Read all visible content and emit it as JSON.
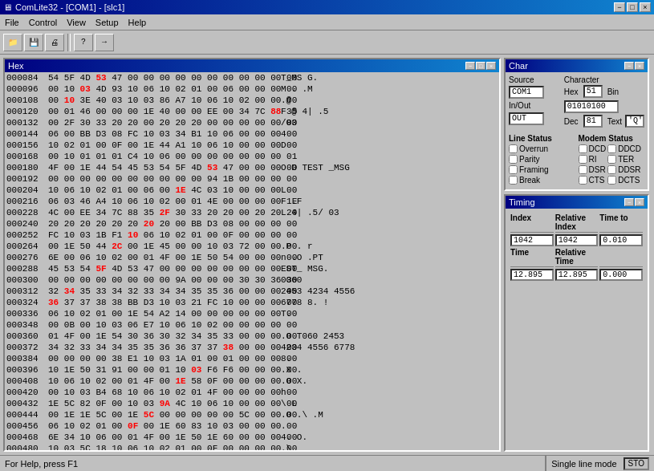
{
  "titleBar": {
    "title": "ComLite32 - [COM1] - [slc1]",
    "minimizeBtn": "−",
    "maximizeBtn": "□",
    "closeBtn": "×"
  },
  "menuBar": {
    "items": [
      "File",
      "Control",
      "View",
      "Setup",
      "Help"
    ]
  },
  "toolbar": {
    "buttons": [
      "▶",
      "■",
      "✕",
      "?",
      "→"
    ]
  },
  "hexWindow": {
    "title": "Hex",
    "rows": [
      {
        "addr": "000084",
        "bytes": "54 5F 4D 53  47 00 00 00  00 00 00 00  00 00 00 00",
        "ascii": "T_MS G.          "
      },
      {
        "addr": "000096",
        "bytes": "00 10 03 4D  93 10 06 10  02 01 00 06  00 00 00 00",
        "ascii": "   M  .          .M"
      },
      {
        "addr": "000108",
        "bytes": "00 10 3E 40  03 10 03 86  A7 10 06 10  02 00 00 00",
        "ascii": "  .@             "
      },
      {
        "addr": "000120",
        "bytes": "00 01 46 00  00 00 1E 40  00 00 EE 00  34 7C 88 35",
        "ascii": "  F    @         4| .5"
      },
      {
        "addr": "000132",
        "bytes": "00 2F 30 33  20 20 00 20  20 20 00 00  00 00 00 00",
        "ascii": "  /03"
      },
      {
        "addr": "000144",
        "bytes": "06 00 BB D3  08 FC 10 03  34 B1 10 06  00 00 00 00",
        "ascii": "         4"
      },
      {
        "addr": "000156",
        "bytes": "10 02 01 00  0F 00 1E 44  A1 10 06 10  00 00 00 00",
        "ascii": "        D"
      },
      {
        "addr": "000168",
        "bytes": "00 10 01 01  01 C4 10 06  00 00 00 00  00 00 00 01",
        "ascii": "              "
      },
      {
        "addr": "000180",
        "bytes": "4F 00 1E 44  54 45 53 54  5F 4D 53 47  00 00 00 00",
        "ascii": "O  D TEST _MSG"
      },
      {
        "addr": "000192",
        "bytes": "00 00 00 00  00 00 00 00  00 00 94 1B  00 00 00 00",
        "ascii": ""
      },
      {
        "addr": "000204",
        "bytes": "10 06 10 02  01 00 06 00  1E 4C 03 10  00 00 00 00",
        "ascii": "          L"
      },
      {
        "addr": "000216",
        "bytes": "06 03 46 A4  10 06 10 02  00 01 4E 00  00 00 00 1E",
        "ascii": "  F         .F"
      },
      {
        "addr": "000228",
        "bytes": "4C 00 EE 34  7C 88 35 2F  30 33 20 20  00 20 20 20",
        "ascii": "L  4| .5/ 03    "
      },
      {
        "addr": "000240",
        "bytes": "20 20 20 20  20 20 20 20  00 BB D3 08  00 00 00 00",
        "ascii": "              "
      },
      {
        "addr": "000252",
        "bytes": "FC 10 03 1B  F1 10 06 10  02 01 00 0F  00 00 00 00",
        "ascii": "            "
      },
      {
        "addr": "000264",
        "bytes": "00 1E 50 44  2C 00 1E 45  00 00 10 03  72 00 00 00",
        "ascii": "  .P  .       r"
      },
      {
        "addr": "000276",
        "bytes": "6E 00 06 10  02 00 01 4F  00 1E 50 54  00 00 00 00",
        "ascii": "n       .O   .PT"
      },
      {
        "addr": "000288",
        "bytes": "45 53 54 5F  4D 53 47 00  00 00 00 00  00 00 00 00",
        "ascii": "EST_ MSG."
      },
      {
        "addr": "000300",
        "bytes": "00 00 00 00  00 00 00 00  9A 00 00 00  30 30 36 30",
        "ascii": "              0060"
      },
      {
        "addr": "000312",
        "bytes": "32 34 35 33  34 32 33 34  34 35 35 36  00 00 00 00",
        "ascii": "2453 4234 4556"
      },
      {
        "addr": "000324",
        "bytes": "36 37 37 38  38 BB D3 10  03 21 FC 10  00 00 00 00",
        "ascii": "6778 8.   !"
      },
      {
        "addr": "000336",
        "bytes": "06 10 02 01  00 1E 54 A2  14 00 00 00  00 00 00 00",
        "ascii": "      T."
      },
      {
        "addr": "000348",
        "bytes": "00 0B 00 10  03 06 E7 10  06 10 02 00  00 00 00 00",
        "ascii": ""
      },
      {
        "addr": "000360",
        "bytes": "01 4F 00 1E  54 30 36 30  32 34 35 33  00 00 00 00",
        "ascii": "  .O  T060 2453"
      },
      {
        "addr": "000372",
        "bytes": "34 32 33 34  34 35 35 36  36 37 37 38  00 00 00 00",
        "ascii": "4234 4556 6778"
      },
      {
        "addr": "000384",
        "bytes": "00 00 00 00  38 E1 10 03  1A 01 00 01  00 00 00 00",
        "ascii": "        8."
      },
      {
        "addr": "000396",
        "bytes": "10 1E 50 31  91 00 00 01  10 03 F6 F6  00 00 00 00",
        "ascii": "  .X          ."
      },
      {
        "addr": "000408",
        "bytes": "10 06 10 02  00 01 4F 00  1E 58 0F 00  00 00 00 00",
        "ascii": "       .O   X."
      },
      {
        "addr": "000420",
        "bytes": "00 10 03 B4  68 10 06 10  02 01 4F 00  00 00 00 00",
        "ascii": "         h"
      },
      {
        "addr": "000432",
        "bytes": "1E 5C 82 0F  00 10 03 9A  4C 10 06 10  00 00 00 00",
        "ascii": "  \\            L"
      },
      {
        "addr": "000444",
        "bytes": "00 1E 1E 5C  00 1E 5C 00  00 00 00 00  5C 00 00 00",
        "ascii": "   .O   .\\  .M"
      },
      {
        "addr": "000456",
        "bytes": "06 10 02 01  00 0F 00 1E  60 83 10 03  00 00 00 00",
        "ascii": "             ."
      },
      {
        "addr": "000468",
        "bytes": "6E 34 10 06  00 01 4F 00  1E 50 1E 60  00 00 00 00",
        "ascii": "  4.      O."
      },
      {
        "addr": "000480",
        "bytes": "10 03 5C 18  10 06 10 02  01 00 0F 00  00 00 00 00",
        "ascii": "  .\\             "
      }
    ]
  },
  "charPanel": {
    "title": "Char",
    "sourceLabel": "Source",
    "sourcePort": "COM1",
    "characterLabel": "Character",
    "hexLabel": "Hex",
    "hexValue": "51",
    "binLabel": "Bin",
    "binValue": "01010100",
    "inOutLabel": "In/Out",
    "inOutValue": "OUT",
    "decLabel": "Dec",
    "decValue": "81",
    "textLabel": "Text",
    "textValue": "'Q'",
    "lineStatusLabel": "Line Status",
    "modemStatusLabel": "Modem Status",
    "overrunLabel": "Overrun",
    "dcdLabel": "DCD",
    "ddcdLabel": "DDCD",
    "parityLabel": "Parity",
    "riLabel": "RI",
    "terLabel": "TER",
    "framingLabel": "Framing",
    "dsrLabel": "DSR",
    "ddsrLabel": "DDSR",
    "breakLabel": "Break",
    "ctsLabel": "CTS",
    "dctsLabel": "DCTS"
  },
  "timingPanel": {
    "title": "Timing",
    "indexLabel": "Index",
    "relativeIndexLabel": "Relative Index",
    "timeToLabel": "Time to",
    "indexValue": "1042",
    "relativeIndexValue": "1042",
    "timeToValue": "0.010",
    "timeLabel": "Time",
    "relativeTimeLabel": "Relative Time",
    "timeValue": "12.895",
    "relativeTimeValue": "12.895",
    "timeToValue2": "0.000"
  },
  "statusBar": {
    "helpText": "For Help, press F1",
    "mode": "Single line mode",
    "indicator": "STO"
  }
}
